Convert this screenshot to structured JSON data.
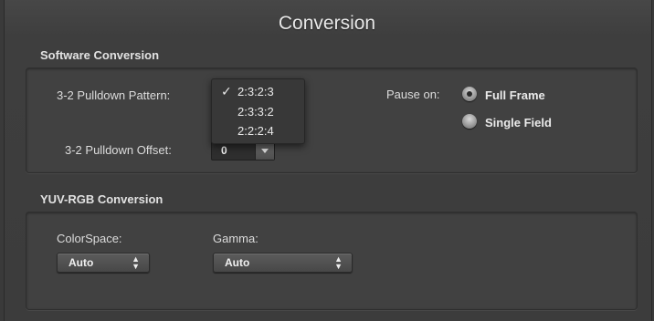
{
  "panel": {
    "title": "Conversion"
  },
  "software": {
    "header": "Software Conversion",
    "pulldown_pattern_label": "3-2 Pulldown Pattern:",
    "pulldown_pattern_options": [
      "2:3:2:3",
      "2:3:3:2",
      "2:2:2:4"
    ],
    "pulldown_pattern_selected": "2:3:2:3",
    "check_glyph": "✓",
    "pulldown_offset_label": "3-2 Pulldown Offset:",
    "pulldown_offset_value": "0",
    "pause_on_label": "Pause on:",
    "pause_options": [
      {
        "label": "Full Frame",
        "selected": true
      },
      {
        "label": "Single Field",
        "selected": false
      }
    ]
  },
  "yuv": {
    "header": "YUV-RGB Conversion",
    "colorspace_label": "ColorSpace:",
    "colorspace_value": "Auto",
    "gamma_label": "Gamma:",
    "gamma_value": "Auto"
  }
}
